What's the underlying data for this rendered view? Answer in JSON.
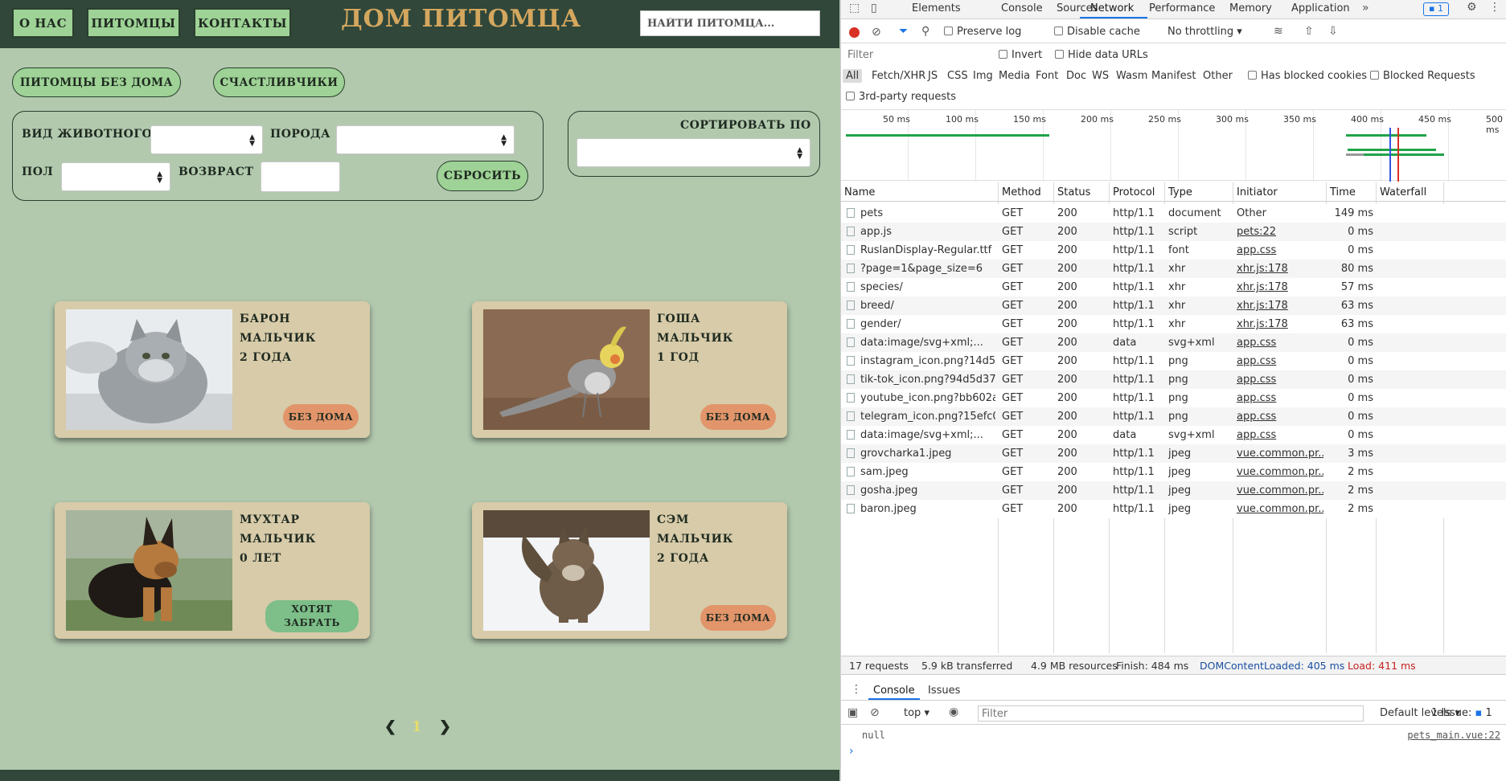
{
  "site": {
    "nav": [
      "О НАС",
      "ПИТОМЦЫ",
      "КОНТАКТЫ"
    ],
    "title": "ДОМ ПИТОМЦА",
    "search_placeholder": "НАЙТИ ПИТОМЦА...",
    "pills": [
      "ПИТОМЦЫ БЕЗ ДОМА",
      "СЧАСТЛИВЧИКИ"
    ],
    "filters": {
      "species_label": "ВИД ЖИВОТНОГО",
      "breed_label": "ПОРОДА",
      "gender_label": "ПОЛ",
      "age_label": "ВОЗВРАСТ",
      "reset": "СБРОСИТЬ",
      "sort_label": "СОРТИРОВАТЬ ПО"
    },
    "pets": [
      {
        "name": "БАРОН",
        "gender": "МАЛЬЧИК",
        "age": "2 ГОДА",
        "status": "БЕЗ ДОМА",
        "photo": "cat-grey"
      },
      {
        "name": "ГОША",
        "gender": "МАЛЬЧИК",
        "age": "1 ГОД",
        "status": "БЕЗ ДОМА",
        "photo": "parrot"
      },
      {
        "name": "МУХТАР",
        "gender": "МАЛЬЧИК",
        "age": "0 ЛЕТ",
        "status": "ХОТЯТ ЗАБРАТЬ",
        "photo": "puppy"
      },
      {
        "name": "СЭМ",
        "gender": "МАЛЬЧИК",
        "age": "2 ГОДА",
        "status": "БЕЗ ДОМА",
        "photo": "cat-snow"
      }
    ],
    "pagination": {
      "prev": "❮",
      "current": "1",
      "next": "❯"
    },
    "colors": {
      "header": "#30473a",
      "bg": "#b2c9ae",
      "accent_green": "#9ed296",
      "card": "#d7cba9",
      "homeless": "#e2956a",
      "wanted": "#7dbe89",
      "title": "#d4a75e"
    }
  },
  "devtools": {
    "tabs": [
      "Elements",
      "Console",
      "Sources",
      "Network",
      "Performance",
      "Memory",
      "Application"
    ],
    "active_tab": "Network",
    "issues_badge": "1",
    "toolbar": {
      "preserve_log": "Preserve log",
      "disable_cache": "Disable cache",
      "throttling": "No throttling"
    },
    "filter_placeholder": "Filter",
    "invert": "Invert",
    "hide_data_urls": "Hide data URLs",
    "types": [
      "All",
      "Fetch/XHR",
      "JS",
      "CSS",
      "Img",
      "Media",
      "Font",
      "Doc",
      "WS",
      "Wasm",
      "Manifest",
      "Other"
    ],
    "has_blocked_cookies": "Has blocked cookies",
    "blocked_requests": "Blocked Requests",
    "third_party": "3rd-party requests",
    "timeline_ticks": [
      "50 ms",
      "100 ms",
      "150 ms",
      "200 ms",
      "250 ms",
      "300 ms",
      "350 ms",
      "400 ms",
      "450 ms",
      "500 ms"
    ],
    "columns": [
      "Name",
      "Method",
      "Status",
      "Protocol",
      "Type",
      "Initiator",
      "Time",
      "Waterfall"
    ],
    "requests": [
      {
        "name": "pets",
        "method": "GET",
        "status": "200",
        "protocol": "http/1.1",
        "type": "document",
        "initiator": "Other",
        "time": "149 ms"
      },
      {
        "name": "app.js",
        "method": "GET",
        "status": "200",
        "protocol": "http/1.1",
        "type": "script",
        "initiator": "pets:22",
        "time": "0 ms"
      },
      {
        "name": "RuslanDisplay-Regular.ttf",
        "method": "GET",
        "status": "200",
        "protocol": "http/1.1",
        "type": "font",
        "initiator": "app.css",
        "time": "0 ms"
      },
      {
        "name": "?page=1&page_size=6",
        "method": "GET",
        "status": "200",
        "protocol": "http/1.1",
        "type": "xhr",
        "initiator": "xhr.js:178",
        "time": "80 ms"
      },
      {
        "name": "species/",
        "method": "GET",
        "status": "200",
        "protocol": "http/1.1",
        "type": "xhr",
        "initiator": "xhr.js:178",
        "time": "57 ms"
      },
      {
        "name": "breed/",
        "method": "GET",
        "status": "200",
        "protocol": "http/1.1",
        "type": "xhr",
        "initiator": "xhr.js:178",
        "time": "63 ms"
      },
      {
        "name": "gender/",
        "method": "GET",
        "status": "200",
        "protocol": "http/1.1",
        "type": "xhr",
        "initiator": "xhr.js:178",
        "time": "63 ms"
      },
      {
        "name": "data:image/svg+xml;...",
        "method": "GET",
        "status": "200",
        "protocol": "data",
        "type": "svg+xml",
        "initiator": "app.css",
        "time": "0 ms"
      },
      {
        "name": "instagram_icon.png?14d5...",
        "method": "GET",
        "status": "200",
        "protocol": "http/1.1",
        "type": "png",
        "initiator": "app.css",
        "time": "0 ms"
      },
      {
        "name": "tik-tok_icon.png?94d5d37...",
        "method": "GET",
        "status": "200",
        "protocol": "http/1.1",
        "type": "png",
        "initiator": "app.css",
        "time": "0 ms"
      },
      {
        "name": "youtube_icon.png?bb602a...",
        "method": "GET",
        "status": "200",
        "protocol": "http/1.1",
        "type": "png",
        "initiator": "app.css",
        "time": "0 ms"
      },
      {
        "name": "telegram_icon.png?15efc0...",
        "method": "GET",
        "status": "200",
        "protocol": "http/1.1",
        "type": "png",
        "initiator": "app.css",
        "time": "0 ms"
      },
      {
        "name": "data:image/svg+xml;...",
        "method": "GET",
        "status": "200",
        "protocol": "data",
        "type": "svg+xml",
        "initiator": "app.css",
        "time": "0 ms"
      },
      {
        "name": "grovcharka1.jpeg",
        "method": "GET",
        "status": "200",
        "protocol": "http/1.1",
        "type": "jpeg",
        "initiator": "vue.common.pr...",
        "time": "3 ms"
      },
      {
        "name": "sam.jpeg",
        "method": "GET",
        "status": "200",
        "protocol": "http/1.1",
        "type": "jpeg",
        "initiator": "vue.common.pr...",
        "time": "2 ms"
      },
      {
        "name": "gosha.jpeg",
        "method": "GET",
        "status": "200",
        "protocol": "http/1.1",
        "type": "jpeg",
        "initiator": "vue.common.pr...",
        "time": "2 ms"
      },
      {
        "name": "baron.jpeg",
        "method": "GET",
        "status": "200",
        "protocol": "http/1.1",
        "type": "jpeg",
        "initiator": "vue.common.pr...",
        "time": "2 ms"
      }
    ],
    "summary": {
      "requests": "17 requests",
      "transferred": "5.9 kB transferred",
      "resources": "4.9 MB resources",
      "finish": "Finish: 484 ms",
      "dcl": "DOMContentLoaded: 405 ms",
      "load": "Load: 411 ms"
    },
    "console": {
      "tabs": [
        "Console",
        "Issues"
      ],
      "context": "top",
      "filter_placeholder": "Filter",
      "levels": "Default levels",
      "issues": "1 Issue: ",
      "issues_count": "1",
      "log_value": "null",
      "log_source": "pets_main.vue:22",
      "prompt": "›"
    }
  }
}
